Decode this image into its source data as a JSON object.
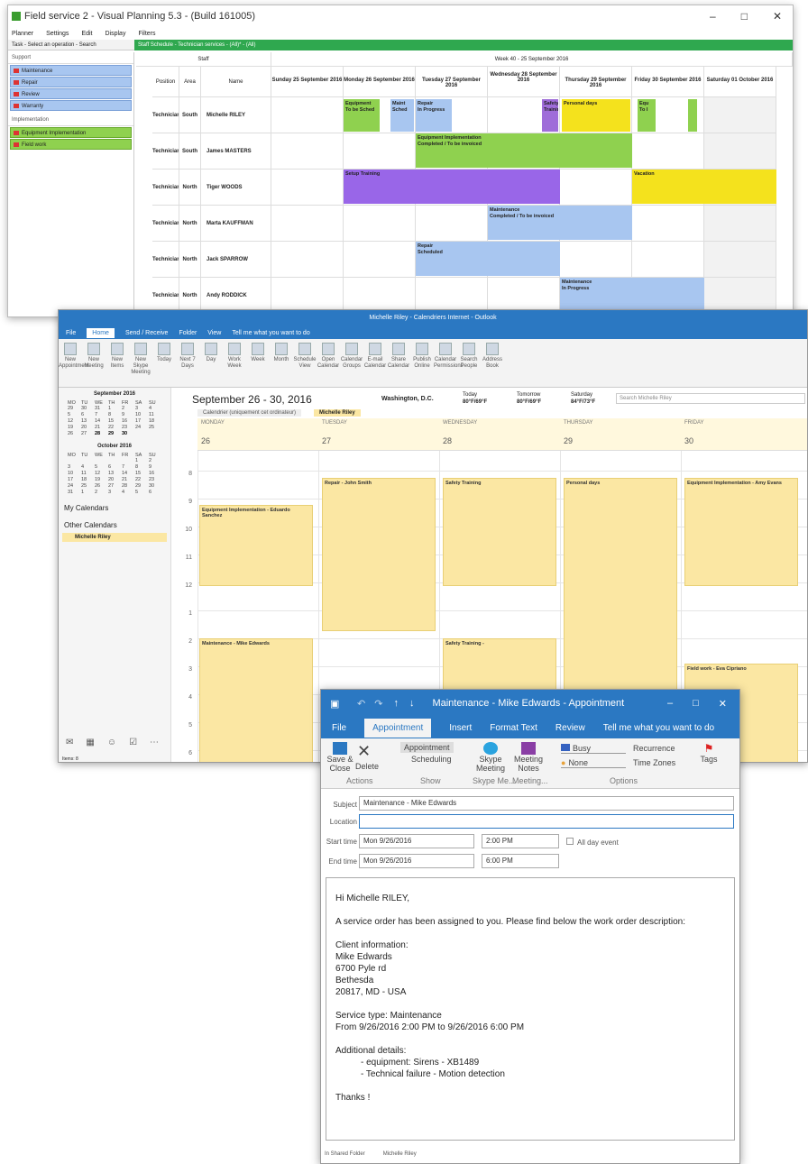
{
  "fs": {
    "title": "Field service 2 - Visual Planning 5.3 - (Build 161005)",
    "menu": [
      "Planner",
      "Settings",
      "Edit",
      "Display",
      "Filters"
    ],
    "task_tab": "Task - Select an operation - Search",
    "schedule_tab": "Staff Schedule - Technician services - (All)* - (All)",
    "groups": [
      {
        "label": "Support",
        "items": [
          "Maintenance",
          "Repair",
          "Review",
          "Warranty"
        ]
      },
      {
        "label": "Implementation",
        "items": [
          "Equipment Implementation",
          "Field work"
        ]
      }
    ],
    "staff_header": "Staff",
    "week_header": "Week 40 - 25 September 2016",
    "col_heads": [
      "Position",
      "Area",
      "Name"
    ],
    "days": [
      "Sunday 25 September 2016",
      "Monday 26 September 2016",
      "Tuesday 27 September 2016",
      "Wednesday 28 September 2016",
      "Thursday 29 September 2016",
      "Friday 30 September 2016",
      "Saturday 01 October 2016"
    ],
    "rows": [
      {
        "position": "Technician",
        "area": "South",
        "name": "Michelle RILEY"
      },
      {
        "position": "Technician",
        "area": "South",
        "name": "James MASTERS"
      },
      {
        "position": "Technician",
        "area": "North",
        "name": "Tiger WOODS"
      },
      {
        "position": "Technician",
        "area": "North",
        "name": "Marta KAUFFMAN"
      },
      {
        "position": "Technician",
        "area": "North",
        "name": "Jack SPARROW"
      },
      {
        "position": "Technician",
        "area": "North",
        "name": "Andy RODDICK"
      }
    ],
    "events": {
      "e1": "Equipment",
      "e1b": "To be Sched",
      "e2": "Maint",
      "e2b": "Sched",
      "e3": "Repair",
      "e3b": "In Progress",
      "e4": "Safety Training",
      "e5": "Personal days",
      "e6": "Equ",
      "e6b": "To I",
      "e7": "Equipment Implementation",
      "e7b": "Completed / To be invoiced",
      "e8": "Setup Training",
      "e9": "Vacation",
      "e10": "Maintenance",
      "e10b": "Completed / To be invoiced",
      "e11": "Repair",
      "e11b": "Scheduled",
      "e12": "Maintenance",
      "e12b": "In Progress"
    }
  },
  "ol": {
    "title": "Michelle Riley - Calendriers Internet - Outlook",
    "tabs": [
      "File",
      "Home",
      "Send / Receive",
      "Folder",
      "View",
      "Tell me what you want to do"
    ],
    "ribbon": [
      "New Appointment",
      "New Meeting",
      "New Items",
      "New Skype Meeting",
      "Today",
      "Next 7 Days",
      "Day",
      "Work Week",
      "Week",
      "Month",
      "Schedule View",
      "Open Calendar",
      "Calendar Groups",
      "E-mail Calendar",
      "Share Calendar",
      "Publish Online",
      "Calendar Permissions",
      "Search People",
      "Address Book"
    ],
    "range": "September 26 - 30, 2016",
    "location": "Washington, D.C.",
    "wx": [
      {
        "day": "Today",
        "temp": "80°F/69°F"
      },
      {
        "day": "Tomorrow",
        "temp": "80°F/69°F"
      },
      {
        "day": "Saturday",
        "temp": "84°F/73°F"
      }
    ],
    "search_ph": "Search Michelle Riley",
    "cal_tab1": "Calendrier (uniquement cet ordinateur)",
    "cal_tab2": "Michelle Riley",
    "mini1": "September 2016",
    "mini2": "October 2016",
    "dow": [
      "MO",
      "TU",
      "WE",
      "TH",
      "FR",
      "SA",
      "SU"
    ],
    "sep": [
      "29",
      "30",
      "31",
      "1",
      "2",
      "3",
      "4",
      "5",
      "6",
      "7",
      "8",
      "9",
      "10",
      "11",
      "12",
      "13",
      "14",
      "15",
      "16",
      "17",
      "18",
      "19",
      "20",
      "21",
      "22",
      "23",
      "24",
      "25",
      "26",
      "27",
      "28",
      "29",
      "30"
    ],
    "oct": [
      "",
      "",
      "",
      "",
      "",
      "1",
      "2",
      "3",
      "4",
      "5",
      "6",
      "7",
      "8",
      "9",
      "10",
      "11",
      "12",
      "13",
      "14",
      "15",
      "16",
      "17",
      "18",
      "19",
      "20",
      "21",
      "22",
      "23",
      "24",
      "25",
      "26",
      "27",
      "28",
      "29",
      "30",
      "31",
      "1",
      "2",
      "3",
      "4",
      "5",
      "6"
    ],
    "mycal": "My Calendars",
    "othercal": "Other Calendars",
    "person": "Michelle Riley",
    "days": [
      {
        "n": "MONDAY",
        "d": "26"
      },
      {
        "n": "TUESDAY",
        "d": "27"
      },
      {
        "n": "WEDNESDAY",
        "d": "28"
      },
      {
        "n": "THURSDAY",
        "d": "29"
      },
      {
        "n": "FRIDAY",
        "d": "30"
      }
    ],
    "hours": [
      "8",
      "9",
      "10",
      "11",
      "12",
      "1",
      "2",
      "3",
      "4",
      "5",
      "6"
    ],
    "evs": {
      "a": "Repair - John Smith",
      "b": "Safety Training",
      "c": "Personal days",
      "d": "Equipment Implementation - Amy Evans",
      "e": "Equipment Implementation - Eduardo Sanchez",
      "f": "Maintenance - Mike Edwards",
      "g": "Safety Training -",
      "h": "Field work - Eva Cipriano"
    },
    "status": "Items: 8"
  },
  "ap": {
    "title": "Maintenance - Mike Edwards - Appointment",
    "tabs": [
      "File",
      "Appointment",
      "Insert",
      "Format Text",
      "Review",
      "Tell me what you want to do"
    ],
    "btns": {
      "save": "Save & Close",
      "delete": "Delete",
      "appt": "Appointment",
      "sched": "Scheduling",
      "skype": "Skype Meeting",
      "notes": "Meeting Notes",
      "busy": "Busy",
      "none": "None",
      "recur": "Recurrence",
      "tz": "Time Zones",
      "tags": "Tags"
    },
    "groups": [
      "Actions",
      "Show",
      "Skype Me...",
      "Meeting...",
      "Options"
    ],
    "subject_l": "Subject",
    "subject": "Maintenance - Mike Edwards",
    "location_l": "Location",
    "start_l": "Start time",
    "start_d": "Mon 9/26/2016",
    "start_t": "2:00 PM",
    "end_l": "End time",
    "end_d": "Mon 9/26/2016",
    "end_t": "6:00 PM",
    "allday": "All day event",
    "body": [
      "Hi Michelle RILEY,",
      "A service order has been assigned to you. Please find below the work order description:",
      "Client information:",
      "Mike Edwards",
      "6700 Pyle rd",
      "Bethesda",
      "20817, MD  - USA",
      "Service type: Maintenance",
      "From 9/26/2016 2:00 PM to 9/26/2016 6:00 PM",
      "Additional details:",
      "- equipment: Sirens  - XB1489",
      "- Technical failure - Motion detection",
      "Thanks !"
    ],
    "footer": "In Shared Folder",
    "footer_name": "Michelle Riley"
  }
}
